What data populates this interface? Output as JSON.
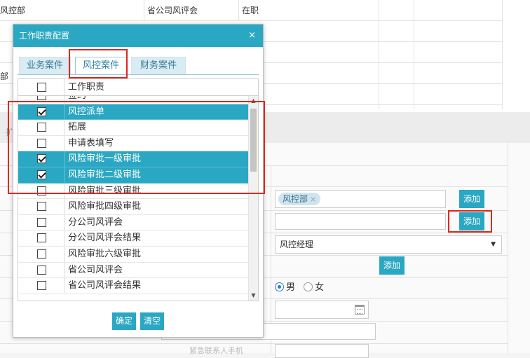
{
  "background": {
    "row1": {
      "dept": "风控部",
      "review": "省公司风评会",
      "status": "在职"
    },
    "partial_dept": "部",
    "partial_tab": "扩",
    "tag_label": "风控部",
    "tag_remove": "×",
    "add_label": "添加",
    "select_value": "风控经理",
    "gender": {
      "male": "男",
      "female": "女",
      "selected": "male"
    },
    "faded_label": "紧急联系人手机"
  },
  "modal": {
    "title": "工作职责配置",
    "close": "×",
    "tabs": [
      {
        "label": "业务案件",
        "active": false
      },
      {
        "label": "风控案件",
        "active": true
      },
      {
        "label": "财务案件",
        "active": false
      }
    ],
    "column_header": "工作职责",
    "header_checked": false,
    "rows": [
      {
        "label": "签约",
        "checked": false
      },
      {
        "label": "风控派单",
        "checked": true
      },
      {
        "label": "拓展",
        "checked": false
      },
      {
        "label": "申请表填写",
        "checked": false
      },
      {
        "label": "风险审批一级审批",
        "checked": true
      },
      {
        "label": "风险审批二级审批",
        "checked": true
      },
      {
        "label": "风险审批三级审批",
        "checked": false
      },
      {
        "label": "风险审批四级审批",
        "checked": false
      },
      {
        "label": "分公司风评会",
        "checked": false
      },
      {
        "label": "分公司风评会结果",
        "checked": false
      },
      {
        "label": "风险审批六级审批",
        "checked": false
      },
      {
        "label": "省公司风评会",
        "checked": false
      },
      {
        "label": "省公司风评会结果",
        "checked": false
      }
    ],
    "confirm_label": "确定",
    "clear_label": "清空"
  },
  "colors": {
    "accent": "#2aa7c3",
    "highlight": "#e0271c"
  },
  "icons": {
    "calendar": "calendar-icon",
    "close": "close-icon",
    "caret": "caret-down-icon"
  }
}
